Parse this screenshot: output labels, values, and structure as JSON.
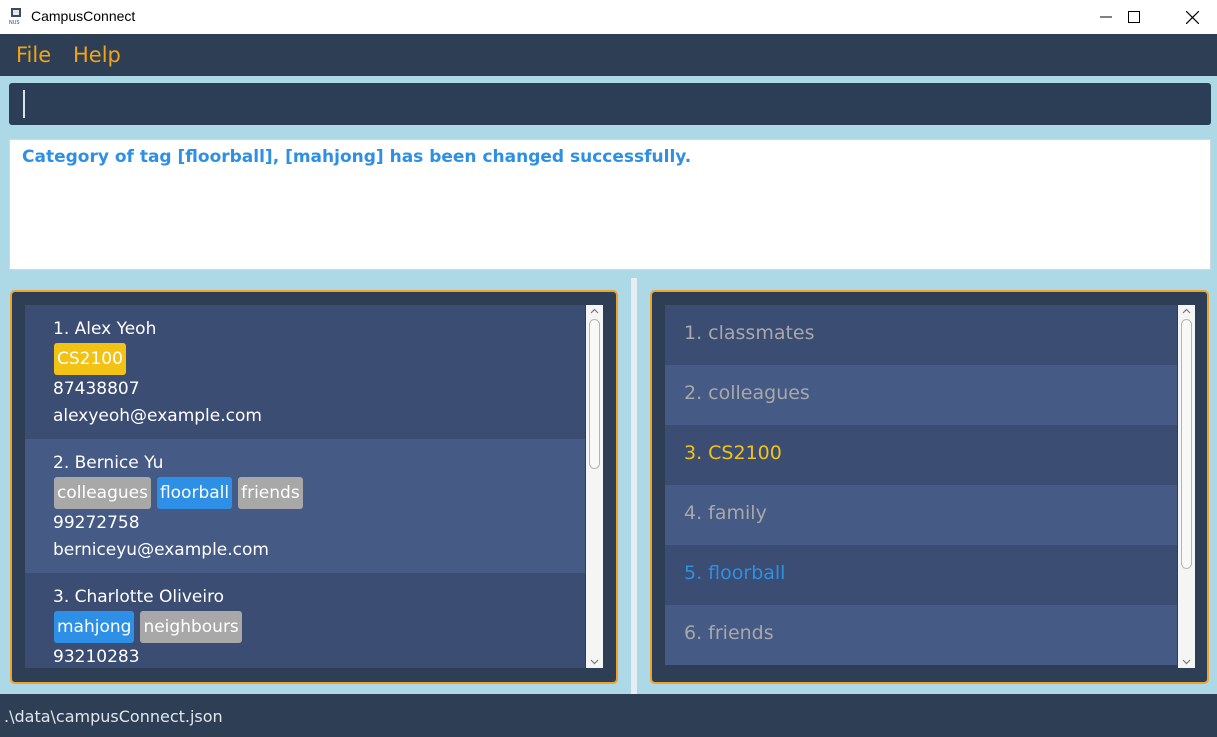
{
  "window": {
    "title": "CampusConnect",
    "app_icon": "nus-logo-icon"
  },
  "menu": {
    "items": [
      {
        "label": "File"
      },
      {
        "label": "Help"
      }
    ]
  },
  "command_box": {
    "value": "",
    "placeholder": ""
  },
  "result": {
    "message": "Category of tag [floorball], [mahjong] has been changed successfully."
  },
  "persons": [
    {
      "name": "1. Alex Yeoh",
      "tags": [
        {
          "label": "CS2100",
          "color": "#f2c315"
        }
      ],
      "phone": "87438807",
      "email": "alexyeoh@example.com"
    },
    {
      "name": "2. Bernice Yu",
      "tags": [
        {
          "label": "colleagues",
          "color": "#a8a8a8"
        },
        {
          "label": "floorball",
          "color": "#2d8fe6"
        },
        {
          "label": "friends",
          "color": "#a8a8a8"
        }
      ],
      "phone": "99272758",
      "email": "berniceyu@example.com"
    },
    {
      "name": "3. Charlotte Oliveiro",
      "tags": [
        {
          "label": "mahjong",
          "color": "#2d8fe6"
        },
        {
          "label": "neighbours",
          "color": "#a8a8a8"
        }
      ],
      "phone": "93210283",
      "email": ""
    }
  ],
  "categories": [
    {
      "label": "1. classmates",
      "color": "#a8a8a8"
    },
    {
      "label": "2. colleagues",
      "color": "#a8a8a8"
    },
    {
      "label": "3. CS2100",
      "color": "#f2c315"
    },
    {
      "label": "4. family",
      "color": "#a8a8a8"
    },
    {
      "label": "5. floorball",
      "color": "#2d8fe6"
    },
    {
      "label": "6. friends",
      "color": "#a8a8a8"
    }
  ],
  "status": {
    "file_path": ".\\data\\campusConnect.json"
  },
  "colors": {
    "accent": "#f2a417",
    "panel_border": "#f0a22e",
    "background": "#add8e6",
    "dark": "#2e3f55"
  }
}
